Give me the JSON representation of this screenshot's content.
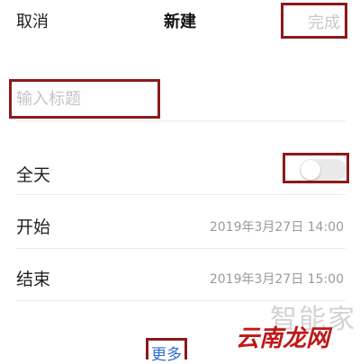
{
  "nav": {
    "cancel_label": "取消",
    "title": "新建",
    "done_label": "完成"
  },
  "title_input": {
    "placeholder": "输入标题",
    "value": ""
  },
  "all_day": {
    "label": "全天",
    "enabled": false
  },
  "start": {
    "label": "开始",
    "value": "2019年3月27日 14:00"
  },
  "end": {
    "label": "结束",
    "value": "2019年3月27日 15:00"
  },
  "more_label": "更多",
  "watermark": {
    "top_text": "智能家",
    "main_text": "云南龙网"
  },
  "colors": {
    "highlight_border": "#8b1a1a",
    "link_blue": "#2f6cd8",
    "disabled_gray": "#c8c8c8"
  }
}
